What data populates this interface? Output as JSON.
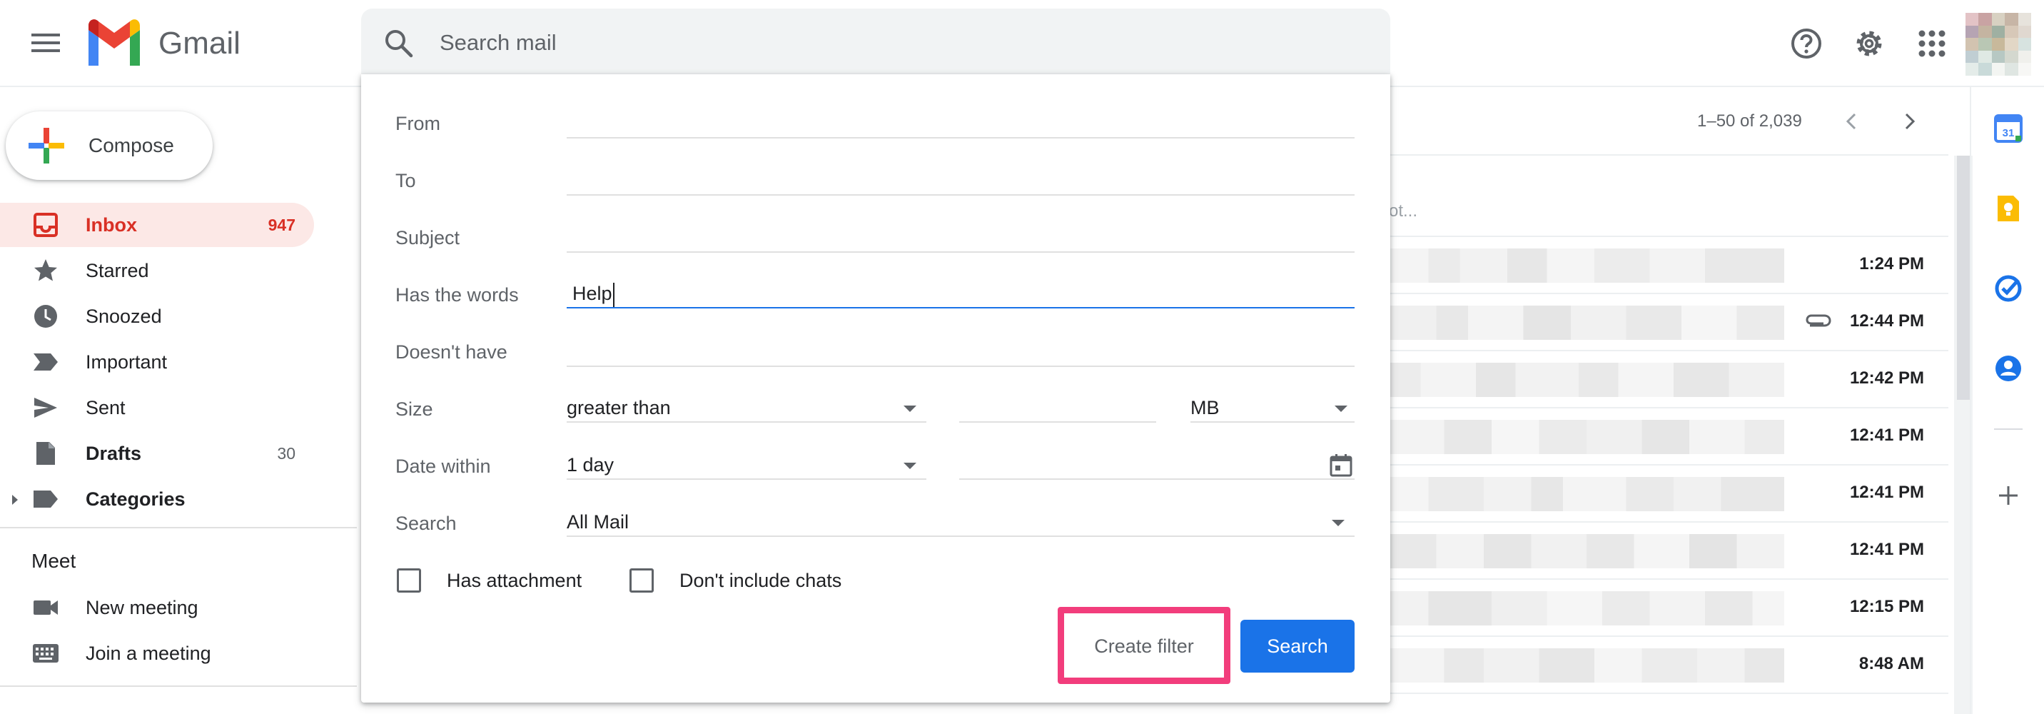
{
  "app": {
    "brand": "Gmail"
  },
  "search": {
    "placeholder": "Search mail"
  },
  "compose": {
    "label": "Compose"
  },
  "sidebar": {
    "items": [
      {
        "label": "Inbox",
        "count": "947",
        "icon": "inbox-icon"
      },
      {
        "label": "Starred",
        "count": "",
        "icon": "star-icon"
      },
      {
        "label": "Snoozed",
        "count": "",
        "icon": "clock-icon"
      },
      {
        "label": "Important",
        "count": "",
        "icon": "important-icon"
      },
      {
        "label": "Sent",
        "count": "",
        "icon": "send-icon"
      },
      {
        "label": "Drafts",
        "count": "30",
        "icon": "draft-icon"
      },
      {
        "label": "Categories",
        "count": "",
        "icon": "label-icon"
      }
    ],
    "meet": {
      "heading": "Meet",
      "items": [
        {
          "label": "New meeting",
          "icon": "video-icon"
        },
        {
          "label": "Join a meeting",
          "icon": "keyboard-icon"
        }
      ]
    }
  },
  "advanced_search": {
    "from_label": "From",
    "to_label": "To",
    "subject_label": "Subject",
    "has_words_label": "Has the words",
    "has_words_value": "Help",
    "doesnt_have_label": "Doesn't have",
    "size_label": "Size",
    "size_operator": "greater than",
    "size_unit": "MB",
    "date_within_label": "Date within",
    "date_within_value": "1 day",
    "search_label": "Search",
    "search_scope": "All Mail",
    "has_attachment_label": "Has attachment",
    "dont_include_chats_label": "Don't include chats",
    "create_filter_label": "Create filter",
    "search_button_label": "Search"
  },
  "mail_list": {
    "pager": "1–50 of 2,039",
    "snippet_tail": "ot...",
    "times": [
      "1:24 PM",
      "12:44 PM",
      "12:42 PM",
      "12:41 PM",
      "12:41 PM",
      "12:41 PM",
      "12:15 PM",
      "8:48 AM"
    ]
  },
  "colors": {
    "accent": "#1a73e8",
    "inbox_active_bg": "#fce8e6",
    "inbox_active_text": "#d93025",
    "highlight": "#f23d7c"
  }
}
